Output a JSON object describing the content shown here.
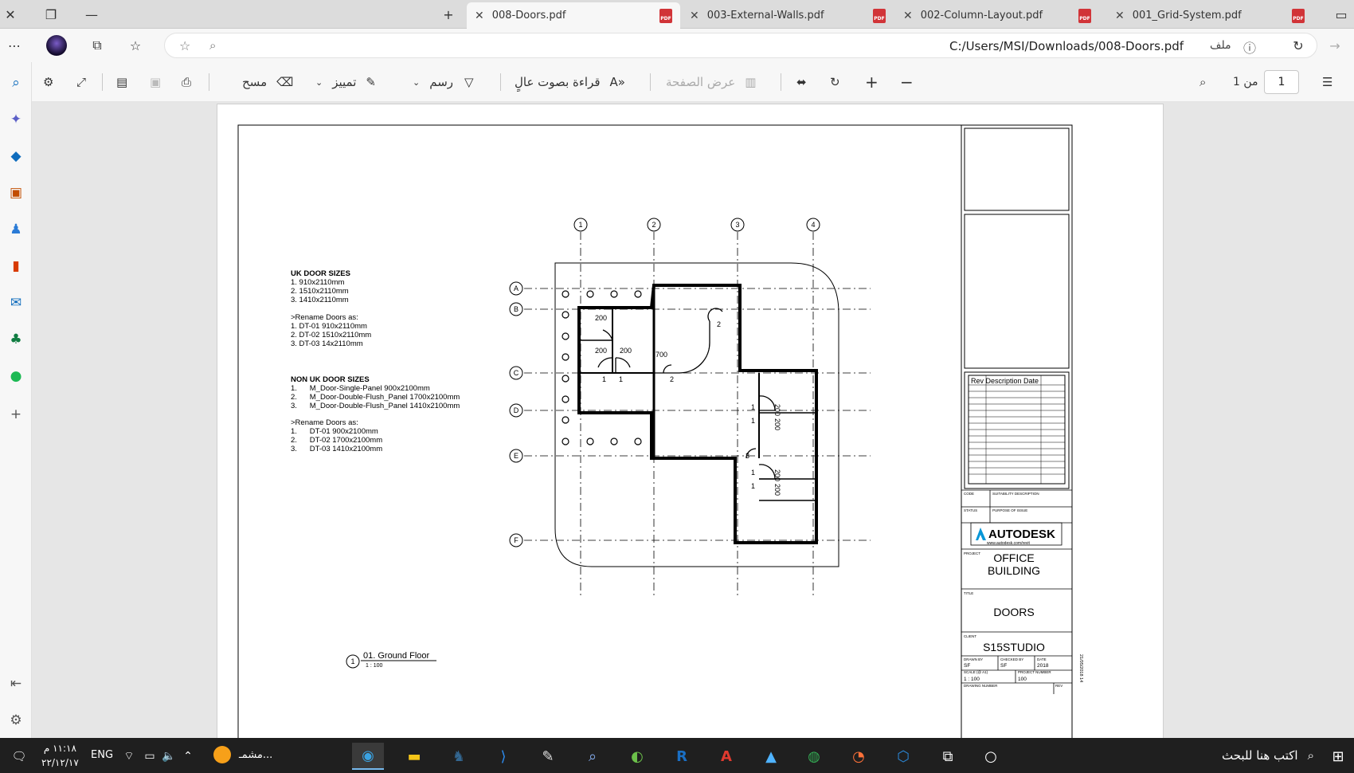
{
  "tabs": [
    {
      "label": "008-Doors.pdf",
      "active": true
    },
    {
      "label": "003-External-Walls.pdf",
      "active": false
    },
    {
      "label": "002-Column-Layout.pdf",
      "active": false
    },
    {
      "label": "001_Grid-System.pdf",
      "active": false
    }
  ],
  "address": {
    "url": "C:/Users/MSI/Downloads/008-Doors.pdf",
    "scheme_label": "ملف"
  },
  "toolbar": {
    "page_current": "1",
    "page_of": "من 1",
    "page_view": "عرض الصفحة",
    "read_aloud": "قراءة بصوت عالٍ",
    "draw": "رسم",
    "highlight": "تمييز",
    "erase": "مسح"
  },
  "notes": {
    "uk_title": "UK DOOR SIZES",
    "uk_sizes": [
      "1. 910x2110mm",
      "2. 1510x2110mm",
      "3. 1410x2110mm"
    ],
    "uk_rename_title": ">Rename Doors as:",
    "uk_rename": [
      "1. DT-01 910x2110mm",
      "2. DT-02 1510x2110mm",
      "3. DT-03 14x2110mm"
    ],
    "non_uk_title": "NON UK DOOR SIZES",
    "non_uk_sizes": [
      "1.      M_Door-Single-Panel 900x2100mm",
      "2.      M_Door-Double-Flush_Panel 1700x2100mm",
      "3.      M_Door-Double-Flush_Panel 1410x2100mm"
    ],
    "non_uk_rename_title": ">Rename Doors as:",
    "non_uk_rename": [
      "1.      DT-01 900x2100mm",
      "2.      DT-02 1700x2100mm",
      "3.      DT-03 1410x2100mm"
    ]
  },
  "view_label": {
    "number": "1",
    "title": "01. Ground Floor",
    "scale": "1 : 100"
  },
  "grid": {
    "cols": [
      "1",
      "2",
      "3",
      "4"
    ],
    "rows": [
      "A",
      "B",
      "C",
      "D",
      "E",
      "F"
    ]
  },
  "dims": [
    "200",
    "200",
    "200",
    "700",
    "200",
    "200",
    "200",
    "200"
  ],
  "door_tags": [
    "1",
    "1",
    "2",
    "2",
    "1",
    "1",
    "1",
    "3",
    "1"
  ],
  "title_block": {
    "rev_header": "Rev Description Date",
    "code_label": "CODE",
    "suitability_label": "SUITABILITY DESCRIPTION",
    "status_label": "STATUS",
    "purpose_label": "PURPOSE OF ISSUE",
    "brand": "AUTODESK",
    "brand_url": "www.autodesk.com/revit",
    "project_label": "PROJECT",
    "project": "OFFICE BUILDING",
    "title_label": "TITLE",
    "title": "DOORS",
    "client_label": "CLIENT",
    "client": "S15STUDIO",
    "drawn_by_label": "DRAWN BY",
    "drawn_by": "SF",
    "checked_by_label": "CHECKED BY",
    "checked_by": "SF",
    "date_label": "DATE",
    "date": "2018",
    "scale_label": "SCALE (@ A1)",
    "scale": "1 : 100",
    "project_number_label": "PROJECT NUMBER",
    "project_number": "100",
    "drawing_number_label": "DRAWING NUMBER",
    "rev_label": "REV",
    "side_date": "21/05/2018 14"
  },
  "taskbar": {
    "time": "١١:١٨ م",
    "date": "٢٢/١٢/١٧",
    "lang": "ENG",
    "search": "اكتب هنا للبحث",
    "app_label": "مشمـ..."
  },
  "colors": {
    "accent": "#0f6cbd",
    "pdf_red": "#d13438",
    "taskbar": "#1f1f1f"
  }
}
